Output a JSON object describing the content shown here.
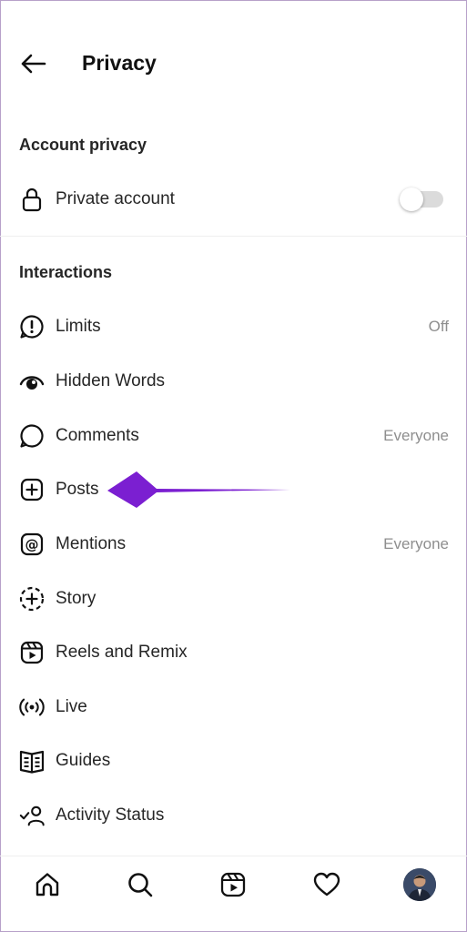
{
  "header": {
    "title": "Privacy"
  },
  "account_privacy": {
    "section_title": "Account privacy",
    "private_account": {
      "label": "Private account",
      "enabled": false
    }
  },
  "interactions": {
    "section_title": "Interactions",
    "items": [
      {
        "label": "Limits",
        "value": "Off",
        "icon": "limits-icon"
      },
      {
        "label": "Hidden Words",
        "value": "",
        "icon": "hidden-words-icon"
      },
      {
        "label": "Comments",
        "value": "Everyone",
        "icon": "comment-icon"
      },
      {
        "label": "Posts",
        "value": "",
        "icon": "plus-square-icon"
      },
      {
        "label": "Mentions",
        "value": "Everyone",
        "icon": "mention-icon"
      },
      {
        "label": "Story",
        "value": "",
        "icon": "story-icon"
      },
      {
        "label": "Reels and Remix",
        "value": "",
        "icon": "reels-icon"
      },
      {
        "label": "Live",
        "value": "",
        "icon": "live-icon"
      },
      {
        "label": "Guides",
        "value": "",
        "icon": "guides-icon"
      },
      {
        "label": "Activity Status",
        "value": "",
        "icon": "activity-status-icon"
      }
    ]
  },
  "annotation": {
    "arrow_color": "#7b1fd1",
    "points_to": "Posts"
  },
  "bottom_nav": [
    "home-icon",
    "search-icon",
    "reels-icon",
    "heart-icon",
    "profile-avatar"
  ]
}
